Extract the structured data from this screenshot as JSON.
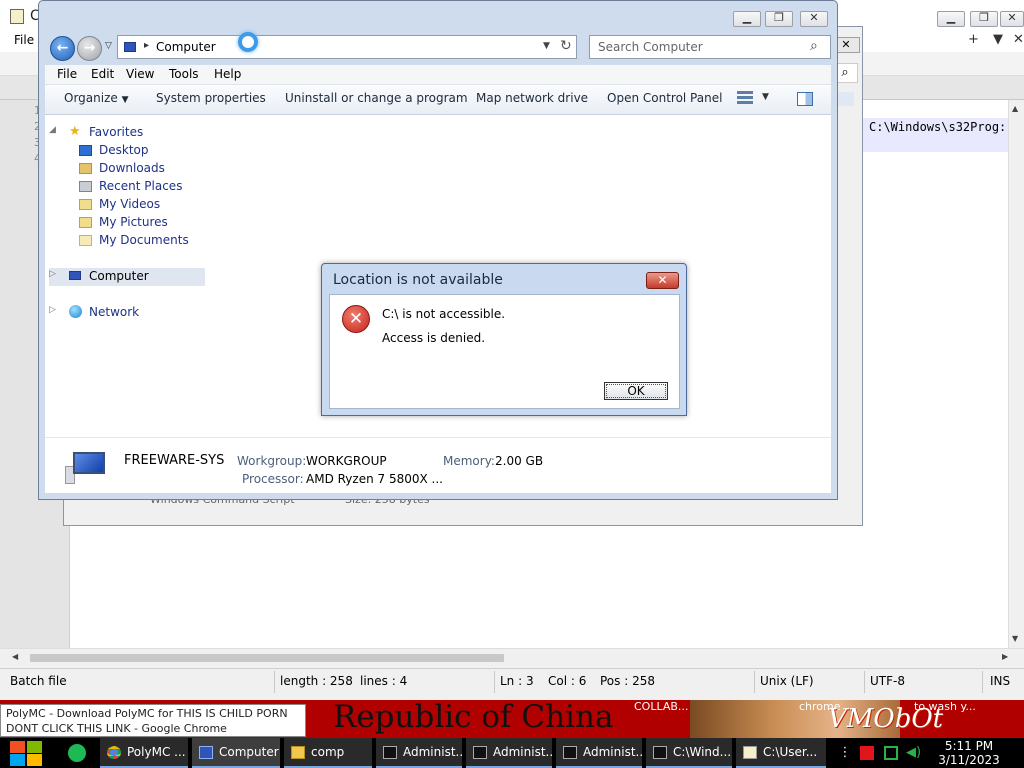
{
  "notepad": {
    "menu_first": "File",
    "line_numbers": [
      "1",
      "2",
      "3",
      "4"
    ],
    "code_fragment": "C:\\Windows\\s32Prog:",
    "status": {
      "type": "Batch file",
      "length": "length : 258",
      "lines": "lines : 4",
      "ln": "Ln : 3",
      "col": "Col : 6",
      "pos": "Pos : 258",
      "eol": "Unix (LF)",
      "encoding": "UTF-8",
      "mode": "INS"
    }
  },
  "behind_window": {
    "peek_type": "Windows Command Script",
    "peek_size": "Size: 258 bytes"
  },
  "explorer": {
    "breadcrumb": "Computer",
    "search_placeholder": "Search Computer",
    "menu": [
      "File",
      "Edit",
      "View",
      "Tools",
      "Help"
    ],
    "commands": {
      "organize": "Organize",
      "system_properties": "System properties",
      "uninstall": "Uninstall or change a program",
      "map_drive": "Map network drive",
      "control_panel": "Open Control Panel"
    },
    "nav": {
      "favorites": "Favorites",
      "desktop": "Desktop",
      "downloads": "Downloads",
      "recent": "Recent Places",
      "videos": "My Videos",
      "pictures": "My Pictures",
      "documents": "My Documents",
      "computer": "Computer",
      "network": "Network"
    },
    "details": {
      "name": "FREEWARE-SYS",
      "workgroup_label": "Workgroup:",
      "workgroup": "WORKGROUP",
      "memory_label": "Memory:",
      "memory": "2.00 GB",
      "processor_label": "Processor:",
      "processor": "AMD Ryzen 7 5800X ..."
    }
  },
  "dialog": {
    "title": "Location is not available",
    "message": "C:\\ is not accessible.",
    "detail": "Access is denied.",
    "ok": "OK"
  },
  "tooltip": {
    "line1": "PolyMC - Download PolyMC for THIS IS CHILD PORN",
    "line2": "DONT CLICK THIS LINK - Google Chrome",
    "banner": "Republic of China",
    "collab": "COLLAB...",
    "chrome": "chrome",
    "vmo": "VMObOt",
    "wash": "to wash y..."
  },
  "taskbar": {
    "apps": [
      "PolyMC ...",
      "Computer",
      "comp",
      "Administ...",
      "Administ...",
      "Administ...",
      "C:\\Wind...",
      "C:\\User..."
    ],
    "time": "5:11 PM",
    "date": "3/11/2023"
  },
  "colors": {
    "explorer_frame": "#cfdcee",
    "error_red": "#c4221a",
    "taskbar": "#000000",
    "banner_red": "#b10000"
  }
}
